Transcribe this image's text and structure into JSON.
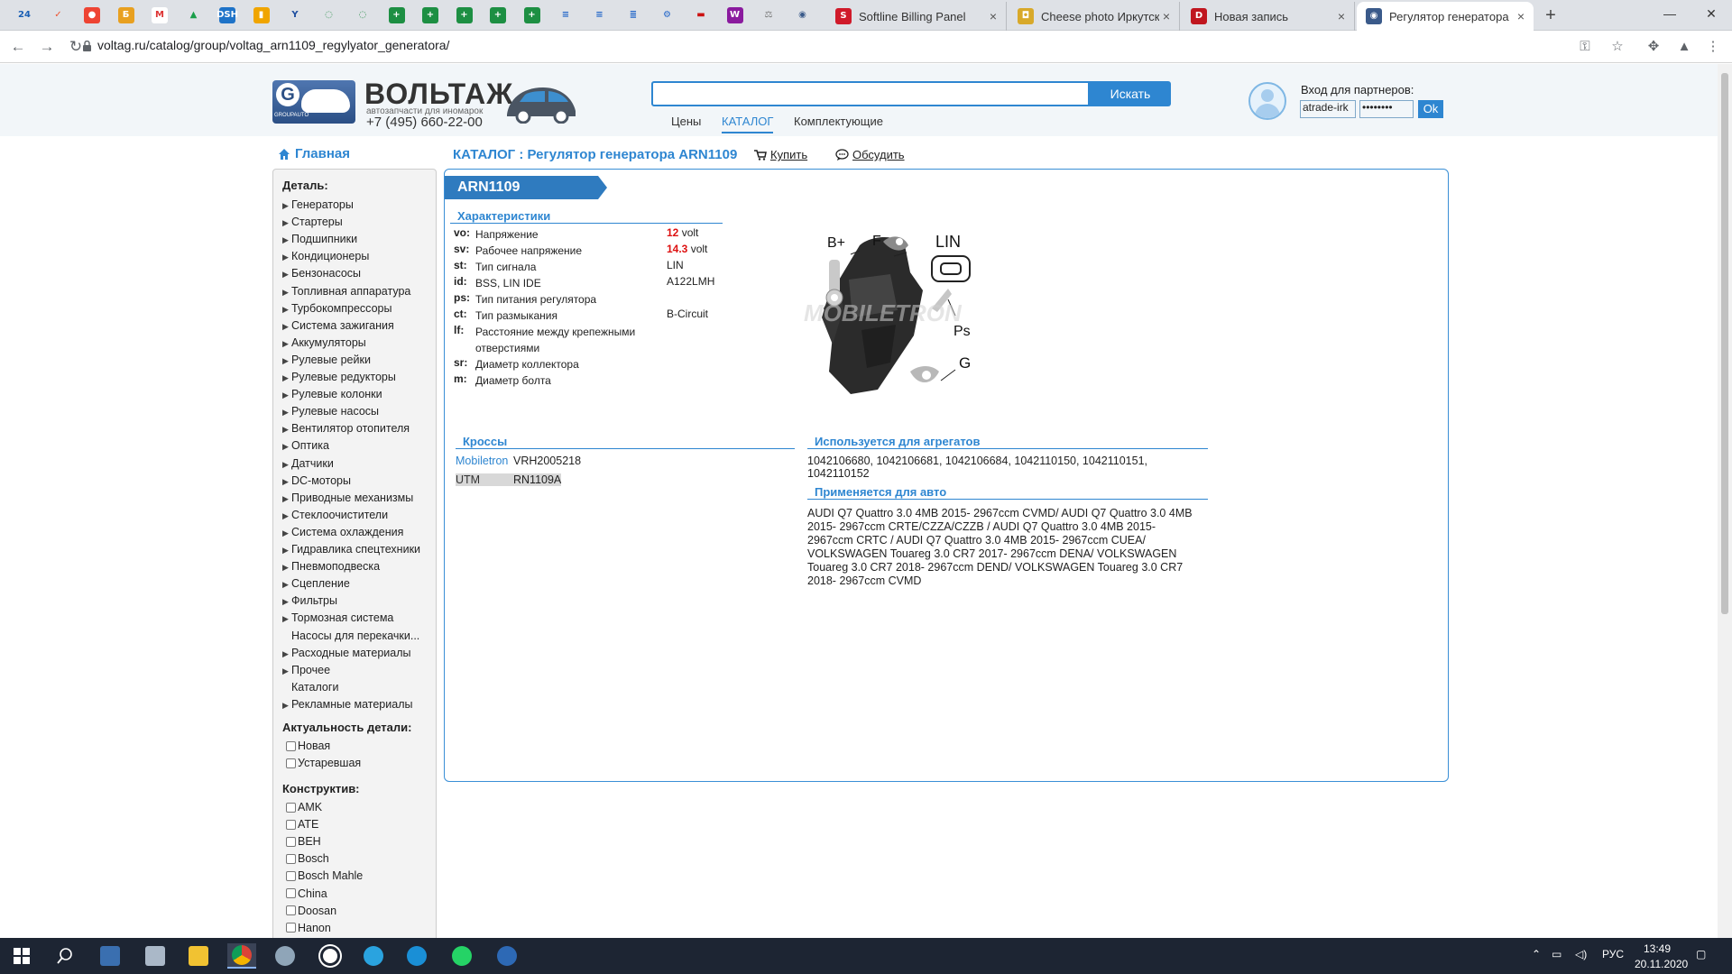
{
  "browser": {
    "favtabs": [
      {
        "label": "24",
        "icon": "24-icon",
        "bg": "#dee1e6",
        "fg": "#1a5fb4"
      },
      {
        "label": "✓",
        "icon": "yandex-icon",
        "bg": "#dee1e6",
        "fg": "#e53"
      },
      {
        "label": "●",
        "icon": "opera-icon",
        "bg": "#e43",
        "fg": "#fff"
      },
      {
        "label": "Б",
        "icon": "bitrix-icon",
        "bg": "#e8a020",
        "fg": "#fff"
      },
      {
        "label": "M",
        "icon": "gmail-icon",
        "bg": "#fff",
        "fg": "#d33"
      },
      {
        "label": "▲",
        "icon": "drive-icon",
        "bg": "#dee1e6",
        "fg": "#1a9e4a"
      },
      {
        "label": "DSH",
        "icon": "dashboard-icon",
        "bg": "#1e73c8",
        "fg": "#fff"
      },
      {
        "label": "▮",
        "icon": "analytics-icon",
        "bg": "#f0a500",
        "fg": "#fff"
      },
      {
        "label": "Y",
        "icon": "yammer-icon",
        "bg": "#dee1e6",
        "fg": "#1e4fa0"
      },
      {
        "label": "◌",
        "icon": "refresh-icon",
        "bg": "#dee1e6",
        "fg": "#2a8f4a"
      },
      {
        "label": "◌",
        "icon": "refresh-icon-2",
        "bg": "#dee1e6",
        "fg": "#2a8f4a"
      },
      {
        "label": "+",
        "icon": "sheets-icon",
        "bg": "#1d8f43",
        "fg": "#fff"
      },
      {
        "label": "+",
        "icon": "sheets-icon-2",
        "bg": "#1d8f43",
        "fg": "#fff"
      },
      {
        "label": "+",
        "icon": "sheets-icon-3",
        "bg": "#1d8f43",
        "fg": "#fff"
      },
      {
        "label": "+",
        "icon": "sheets-icon-4",
        "bg": "#1d8f43",
        "fg": "#fff"
      },
      {
        "label": "+",
        "icon": "sheets-icon-5",
        "bg": "#1d8f43",
        "fg": "#fff"
      },
      {
        "label": "≡",
        "icon": "docs-icon",
        "bg": "#dee1e6",
        "fg": "#1e63c8"
      },
      {
        "label": "≡",
        "icon": "docs-icon-2",
        "bg": "#dee1e6",
        "fg": "#1e63c8"
      },
      {
        "label": "≣",
        "icon": "list-icon",
        "bg": "#dee1e6",
        "fg": "#1e63c8"
      },
      {
        "label": "⚙",
        "icon": "tool-icon",
        "bg": "#dee1e6",
        "fg": "#1e63c8"
      },
      {
        "label": "▬",
        "icon": "flag-ru-icon",
        "bg": "#dee1e6",
        "fg": "#c11"
      },
      {
        "label": "W",
        "icon": "wildberries-icon",
        "bg": "#8a1a9e",
        "fg": "#fff"
      },
      {
        "label": "⚖",
        "icon": "scales-icon",
        "bg": "#dee1e6",
        "fg": "#777"
      },
      {
        "label": "◉",
        "icon": "car-icon",
        "bg": "#dee1e6",
        "fg": "#3a5a8a"
      }
    ],
    "tabs": [
      {
        "label": "Softline Billing Panel",
        "icon": "softline-icon",
        "color": "#d01a2a",
        "glyph": "S"
      },
      {
        "label": "Cheese photo Иркутск",
        "icon": "cheese-icon",
        "color": "#d8a92a",
        "glyph": "◘"
      },
      {
        "label": "Новая запись",
        "icon": "d-icon",
        "color": "#c0161f",
        "glyph": "D"
      },
      {
        "label": "Регулятор генератора",
        "icon": "car-favicon",
        "color": "#3a5a8a",
        "glyph": "◉",
        "active": true
      }
    ],
    "new_tab": "+",
    "url": "voltag.ru/catalog/group/voltag_arn1109_regylyator_generatora/"
  },
  "header": {
    "logo_group": "GROUPAUTO",
    "logo_name": "ВОЛЬТАЖ",
    "logo_slogan": "автозапчасти для иномарок",
    "logo_phone": "+7 (495) 660-22-00",
    "search_button": "Искать",
    "nav": [
      "Цены",
      "КАТАЛОГ",
      "Комплектующие"
    ],
    "partner_label": "Вход для партнеров:",
    "login_value": "atrade-irk",
    "password_value": "••••••••",
    "ok_button": "Ok"
  },
  "breadcrumb": {
    "home": "Главная",
    "catalog": "КАТАЛОГ : Регулятор генератора ARN1109",
    "buy": "Купить",
    "discuss": "Обсудить"
  },
  "sidebar": {
    "detail_title": "Деталь:",
    "items": [
      {
        "label": "Генераторы",
        "arrow": true
      },
      {
        "label": "Стартеры",
        "arrow": true
      },
      {
        "label": "Подшипники",
        "arrow": true
      },
      {
        "label": "Кондиционеры",
        "arrow": true
      },
      {
        "label": "Бензонасосы",
        "arrow": true
      },
      {
        "label": "Топливная аппаратура",
        "arrow": true
      },
      {
        "label": "Турбокомпрессоры",
        "arrow": true
      },
      {
        "label": "Система зажигания",
        "arrow": true
      },
      {
        "label": "Аккумуляторы",
        "arrow": true
      },
      {
        "label": "Рулевые рейки",
        "arrow": true
      },
      {
        "label": "Рулевые редукторы",
        "arrow": true
      },
      {
        "label": "Рулевые колонки",
        "arrow": true
      },
      {
        "label": "Рулевые насосы",
        "arrow": true
      },
      {
        "label": "Вентилятор отопителя",
        "arrow": true
      },
      {
        "label": "Оптика",
        "arrow": true
      },
      {
        "label": "Датчики",
        "arrow": true
      },
      {
        "label": "DC-моторы",
        "arrow": true
      },
      {
        "label": "Приводные механизмы",
        "arrow": true
      },
      {
        "label": "Стеклоочистители",
        "arrow": true
      },
      {
        "label": "Система охлаждения",
        "arrow": true
      },
      {
        "label": "Гидравлика спецтехники",
        "arrow": true
      },
      {
        "label": "Пневмоподвеска",
        "arrow": true
      },
      {
        "label": "Сцепление",
        "arrow": true
      },
      {
        "label": "Фильтры",
        "arrow": true
      },
      {
        "label": "Тормозная система",
        "arrow": true
      },
      {
        "label": "Насосы для перекачки...",
        "arrow": false
      },
      {
        "label": "Расходные материалы",
        "arrow": true
      },
      {
        "label": "Прочее",
        "arrow": true
      },
      {
        "label": "Каталоги",
        "arrow": false
      },
      {
        "label": "Рекламные материалы",
        "arrow": true
      }
    ],
    "relevance_title": "Актуальность детали:",
    "relevance": [
      "Новая",
      "Устаревшая"
    ],
    "constructive_title": "Конструктив:",
    "constructive": [
      "AMK",
      "ATE",
      "BEH",
      "Bosch",
      "Bosch Mahle",
      "China",
      "Doosan",
      "Hanon"
    ]
  },
  "product": {
    "code": "ARN1109",
    "char_title": "Характеристики",
    "chars": [
      {
        "code": "vo:",
        "name": "Напряжение",
        "num": "12",
        "unit": " volt"
      },
      {
        "code": "sv:",
        "name": "Рабочее напряжение",
        "num": "14.3",
        "unit": " volt"
      },
      {
        "code": "st:",
        "name": "Тип сигнала",
        "num": "",
        "unit": "LIN"
      },
      {
        "code": "id:",
        "name": "BSS, LIN IDE",
        "num": "",
        "unit": "A122LMH"
      },
      {
        "code": "ps:",
        "name": "Тип питания регулятора",
        "num": "",
        "unit": ""
      },
      {
        "code": "ct:",
        "name": "Тип размыкания",
        "num": "",
        "unit": "B-Circuit"
      },
      {
        "code": "lf:",
        "name": "Расстояние между крепежными отверстиями",
        "num": "",
        "unit": ""
      },
      {
        "code": "sr:",
        "name": "Диаметр коллектора",
        "num": "",
        "unit": ""
      },
      {
        "code": "m:",
        "name": "Диаметр болта",
        "num": "",
        "unit": ""
      }
    ],
    "image_labels": {
      "bplus": "B+",
      "f": "F",
      "lin": "LIN",
      "ps": "Ps",
      "g": "G",
      "watermark": "MOBILETRON"
    },
    "crosses_title": "Кроссы",
    "crosses": [
      {
        "brand": "Mobiletron",
        "code": "VRH2005218",
        "highlight": false
      },
      {
        "brand": "UTM",
        "code": "RN1109A",
        "highlight": true
      }
    ],
    "agg_title": "Используется для агрегатов",
    "agg_text": "1042106680, 1042106681, 1042106684, 1042110150, 1042110151, 1042110152",
    "auto_title": "Применяется для авто",
    "auto_text": "AUDI Q7 Quattro 3.0 4MB 2015- 2967ccm CVMD/ AUDI Q7 Quattro 3.0 4MB 2015- 2967ccm CRTE/CZZA/CZZB / AUDI Q7 Quattro 3.0 4MB 2015- 2967ccm CRTC / AUDI Q7 Quattro 3.0 4MB 2015- 2967ccm CUEA/ VOLKSWAGEN Touareg 3.0 CR7 2017- 2967ccm DENA/ VOLKSWAGEN Touareg 3.0 CR7 2018- 2967ccm DEND/ VOLKSWAGEN Touareg 3.0 CR7 2018- 2967ccm CVMD"
  },
  "taskbar": {
    "time": "13:49",
    "date": "20.11.2020",
    "lang": "РУС"
  },
  "colors": {
    "accent": "#2e86d1",
    "ribbon": "#2f7bbf",
    "red": "#dd1111"
  }
}
